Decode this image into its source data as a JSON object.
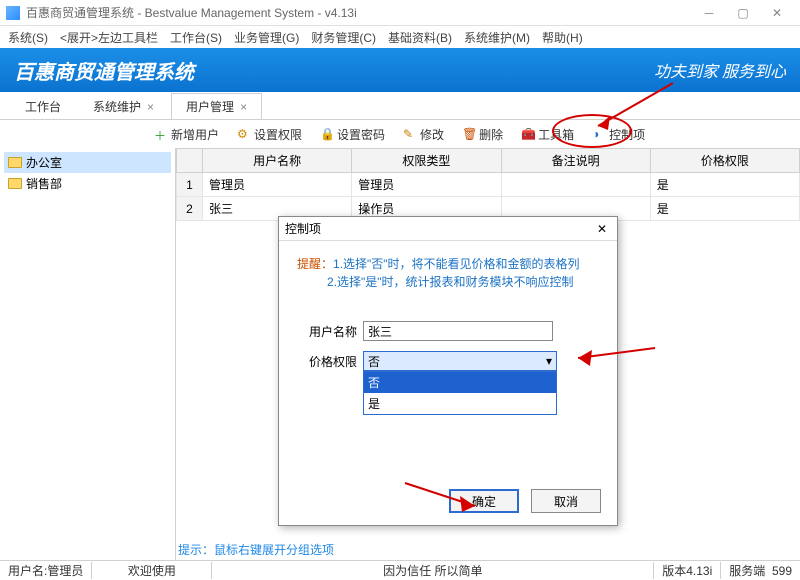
{
  "window": {
    "title": "百惠商贸通管理系统 - Bestvalue Management System - v4.13i"
  },
  "menu": [
    "系统(S)",
    "<展开>左边工具栏",
    "工作台(S)",
    "业务管理(G)",
    "财务管理(C)",
    "基础资料(B)",
    "系统维护(M)",
    "帮助(H)"
  ],
  "banner": {
    "brand": "百惠商贸通管理系统",
    "slogan": "功夫到家 服务到心"
  },
  "tabs": [
    {
      "label": "工作台",
      "closable": false,
      "active": false
    },
    {
      "label": "系统维护",
      "closable": true,
      "active": false
    },
    {
      "label": "用户管理",
      "closable": true,
      "active": true
    }
  ],
  "toolbar": {
    "add": "新增用户",
    "perm": "设置权限",
    "pwd": "设置密码",
    "edit": "修改",
    "del": "删除",
    "tools": "工具箱",
    "ctrl": "控制项"
  },
  "tree": [
    {
      "label": "办公室",
      "selected": true
    },
    {
      "label": "销售部",
      "selected": false
    }
  ],
  "grid": {
    "cols": [
      "用户名称",
      "权限类型",
      "备注说明",
      "价格权限"
    ],
    "rows": [
      {
        "n": "1",
        "name": "管理员",
        "role": "管理员",
        "remark": "",
        "price": "是"
      },
      {
        "n": "2",
        "name": "张三",
        "role": "操作员",
        "remark": "",
        "price": "是"
      }
    ]
  },
  "hint": "提示：鼠标右键展开分组选项",
  "status": {
    "user_label": "用户名:",
    "user": "管理员",
    "welcome": "欢迎使用",
    "motto": "因为信任 所以简单",
    "ver_label": "版本",
    "ver": "4.13i",
    "svc_label": "服务端",
    "svc_days": "599"
  },
  "dialog": {
    "title": "控制项",
    "tip_label": "提醒：",
    "tip1": "1.选择\"否\"时，将不能看见价格和金额的表格列",
    "tip2": "2.选择\"是\"时，统计报表和财务模块不响应控制",
    "field_user": "用户名称",
    "field_price": "价格权限",
    "username": "张三",
    "combo_value": "否",
    "options": [
      "否",
      "是"
    ],
    "ok": "确定",
    "cancel": "取消"
  }
}
